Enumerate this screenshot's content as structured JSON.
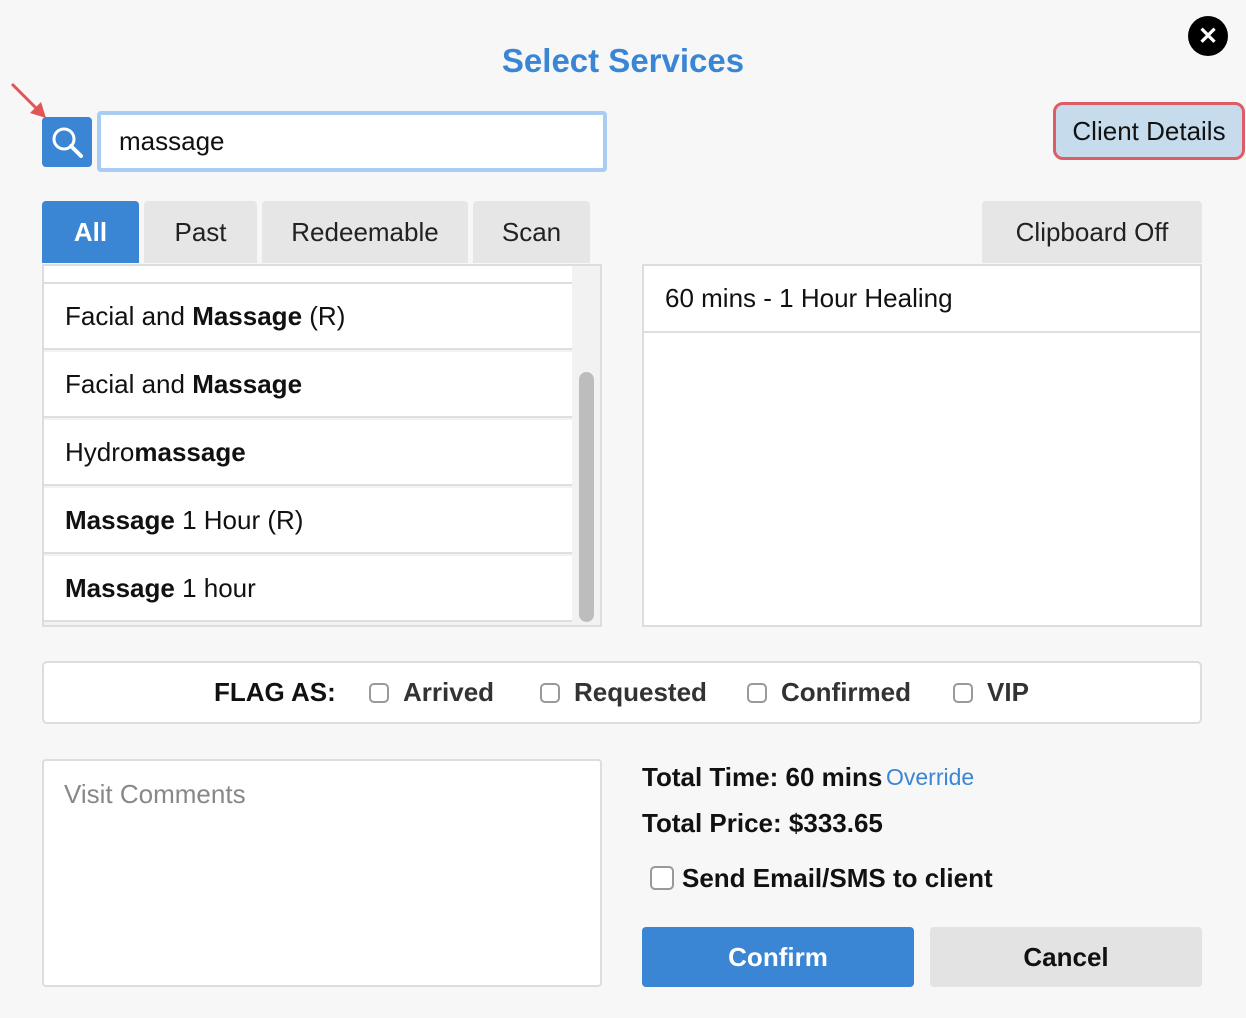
{
  "dialog": {
    "title": "Select Services"
  },
  "search": {
    "value": "massage"
  },
  "client_details_label": "Client Details",
  "tabs": [
    {
      "label": "All",
      "active": true
    },
    {
      "label": "Past",
      "active": false
    },
    {
      "label": "Redeemable",
      "active": false
    },
    {
      "label": "Scan",
      "active": false
    }
  ],
  "clipboard_label": "Clipboard Off",
  "services": [
    {
      "pre": "Facial and ",
      "match": "Massage",
      "post": " (R)"
    },
    {
      "pre": "Facial and ",
      "match": "Massage",
      "post": ""
    },
    {
      "pre": "Hydro",
      "match": "massage",
      "post": ""
    },
    {
      "pre": "",
      "match": "Massage",
      "post": " 1 Hour (R)"
    },
    {
      "pre": "",
      "match": "Massage",
      "post": " 1 hour"
    }
  ],
  "selected_services": [
    "60 mins - 1 Hour Healing"
  ],
  "flags": {
    "label": "FLAG AS:",
    "options": [
      "Arrived",
      "Requested",
      "Confirmed",
      "VIP"
    ]
  },
  "comments": {
    "placeholder": "Visit Comments"
  },
  "totals": {
    "time_label": "Total Time:",
    "time_value": "60 mins",
    "override_label": "Override",
    "price_label": "Total Price:",
    "price_value": "$333.65"
  },
  "send_label": "Send Email/SMS to client",
  "confirm_label": "Confirm",
  "cancel_label": "Cancel",
  "colors": {
    "accent": "#3a86d4",
    "highlight_border": "#de5c63",
    "client_bg": "#c6dcec"
  },
  "icons": {
    "close": "close-icon",
    "search": "search-icon",
    "annotation": "arrow-annotation-icon"
  }
}
